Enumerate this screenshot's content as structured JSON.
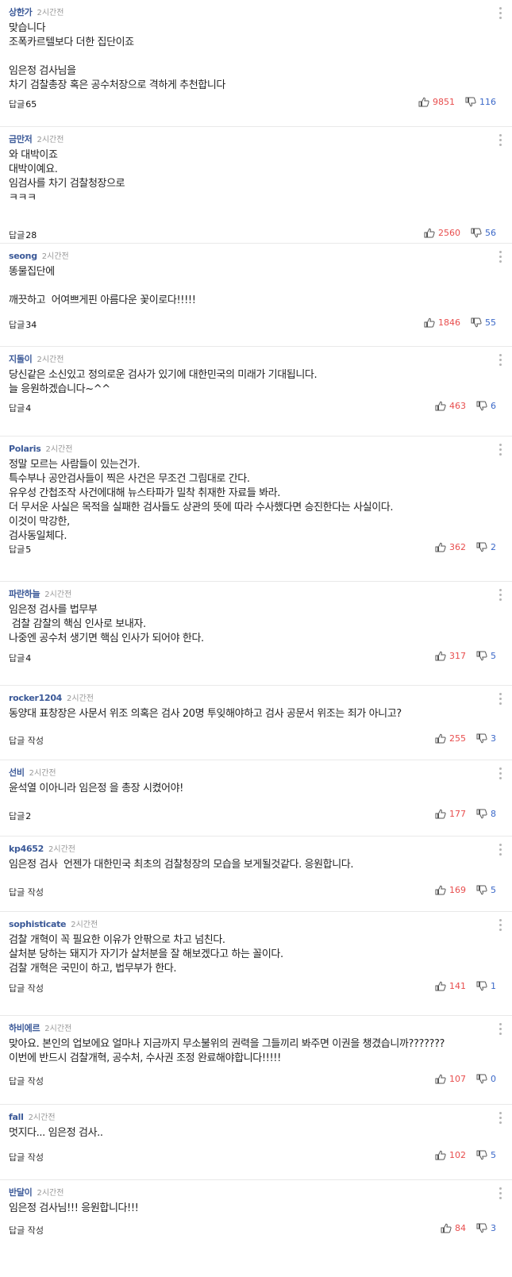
{
  "comments": [
    {
      "author": "상한가",
      "time": "2시간전",
      "lines": [
        "맞습니다",
        "조폭카르텔보다 더한 집단이죠",
        "",
        "임은정 검사님을",
        "차기 검찰총장 혹은 공수처장으로 격하게 추천합니다"
      ],
      "reply_label": "답글",
      "reply_count": "65",
      "likes": "9851",
      "dislikes": "116"
    },
    {
      "author": "금만저",
      "time": "2시간전",
      "lines": [
        "와 대박이죠",
        "대박이예요.",
        "임검사를 차기 검찰청장으로",
        "ㅋㅋㅋ"
      ],
      "reply_label": "답글",
      "reply_count": "28",
      "likes": "2560",
      "dislikes": "56"
    },
    {
      "author": "seong",
      "time": "2시간전",
      "lines": [
        "똥물집단에",
        "",
        "깨끗하고  어여쁘게핀 아름다운 꽃이로다!!!!!"
      ],
      "reply_label": "답글",
      "reply_count": "34",
      "likes": "1846",
      "dislikes": "55"
    },
    {
      "author": "지돌이",
      "time": "2시간전",
      "lines": [
        "당신같은 소신있고 정의로운 검사가 있기에 대한민국의 미래가 기대됩니다.",
        "늘 응원하겠습니다~^^"
      ],
      "reply_label": "답글",
      "reply_count": "4",
      "likes": "463",
      "dislikes": "6"
    },
    {
      "author": "Polaris",
      "time": "2시간전",
      "lines": [
        "정말 모르는 사람들이 있는건가.",
        "특수부나 공안검사들이 찍은 사건은 무조건 그림대로 간다.",
        "유우성 간첩조작 사건에대해 뉴스타파가 밀착 취재한 자료들 봐라.",
        "더 무서운 사실은 목적을 실패한 검사들도 상관의 뜻에 따라 수사했다면 승진한다는 사실이다.",
        "이것이 막강한,",
        "검사동일체다."
      ],
      "reply_label": "답글",
      "reply_count": "5",
      "likes": "362",
      "dislikes": "2"
    },
    {
      "author": "파란하늘",
      "time": "2시간전",
      "lines": [
        "임은정 검사를 법무부",
        " 검찰 감찰의 핵심 인사로 보내자.",
        "나중엔 공수처 생기면 핵심 인사가 되어야 한다."
      ],
      "reply_label": "답글",
      "reply_count": "4",
      "likes": "317",
      "dislikes": "5"
    },
    {
      "author": "rocker1204",
      "time": "2시간전",
      "lines": [
        "동양대 표창장은 사문서 위조 의혹은 검사 20명 투잊해야하고 검사 공문서 위조는 죄가 아니고?"
      ],
      "reply_label": "답글 작성",
      "reply_count": "",
      "likes": "255",
      "dislikes": "3"
    },
    {
      "author": "선비",
      "time": "2시간전",
      "lines": [
        "윤석열 이아니라 임은정 을 총장 시켰어야!"
      ],
      "reply_label": "답글",
      "reply_count": "2",
      "likes": "177",
      "dislikes": "8"
    },
    {
      "author": "kp4652",
      "time": "2시간전",
      "lines": [
        "임은정 검사  언젠가 대한민국 최초의 검찰청장의 모습을 보게될것같다. 응원합니다."
      ],
      "reply_label": "답글 작성",
      "reply_count": "",
      "likes": "169",
      "dislikes": "5"
    },
    {
      "author": "sophisticate",
      "time": "2시간전",
      "lines": [
        "검찰 개혁이 꼭 필요한 이유가 안팎으로 차고 넘친다.",
        "살처분 당하는 돼지가 자기가 살처분을 잘 해보겠다고 하는 꼴이다.",
        "검찰 개혁은 국민이 하고, 법무부가 한다."
      ],
      "reply_label": "답글 작성",
      "reply_count": "",
      "likes": "141",
      "dislikes": "1"
    },
    {
      "author": "하비에르",
      "time": "2시간전",
      "lines": [
        "맞아요. 본인의 업보에요 얼마나 지금까지 무소불위의 권력을 그들끼리 봐주면 이권을 챙겼습니까???????",
        "이번에 반드시 검찰개혁, 공수처, 수사권 조정 완료해야합니다!!!!!"
      ],
      "reply_label": "답글 작성",
      "reply_count": "",
      "likes": "107",
      "dislikes": "0"
    },
    {
      "author": "fall",
      "time": "2시간전",
      "lines": [
        "멋지다... 임은정 검사.."
      ],
      "reply_label": "답글 작성",
      "reply_count": "",
      "likes": "102",
      "dislikes": "5"
    },
    {
      "author": "반달이",
      "time": "2시간전",
      "lines": [
        "임은정 검사님!!! 응원합니다!!!"
      ],
      "reply_label": "답글 작성",
      "reply_count": "",
      "likes": "84",
      "dislikes": "3"
    }
  ]
}
